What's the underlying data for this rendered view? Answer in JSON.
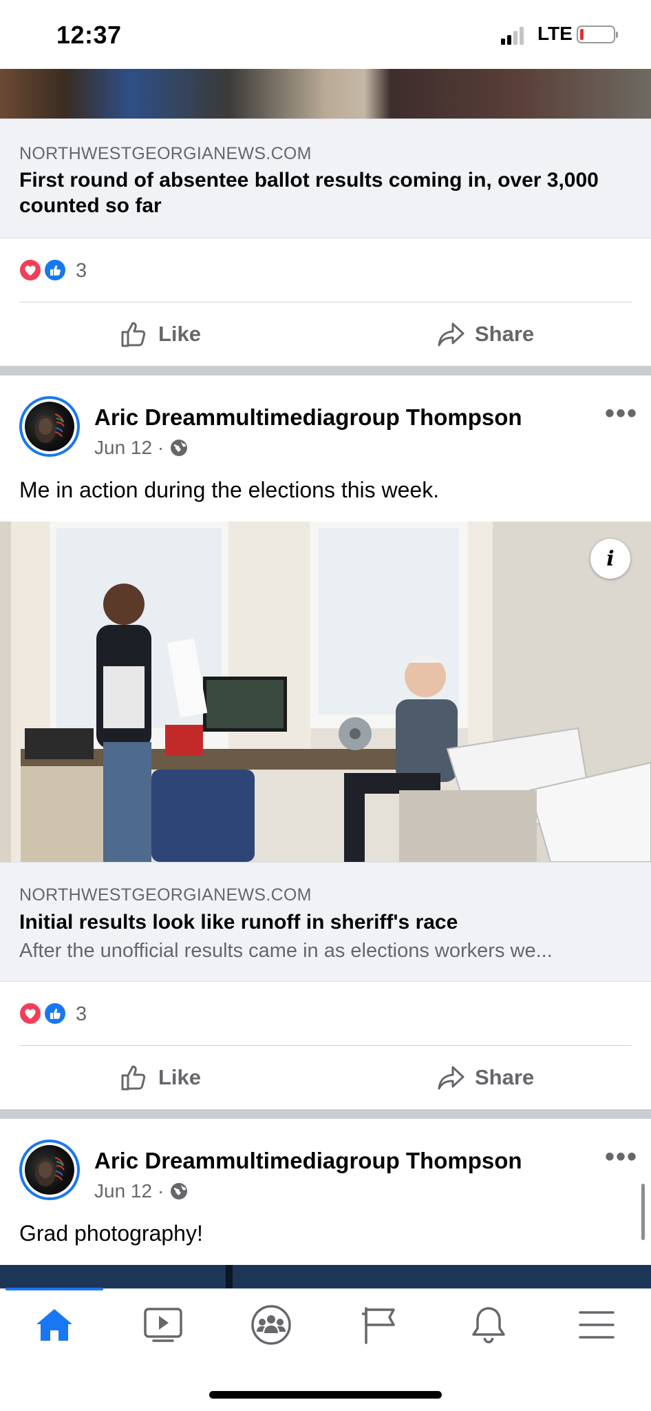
{
  "status": {
    "time": "12:37",
    "network": "LTE"
  },
  "posts": [
    {
      "link": {
        "domain": "NORTHWESTGEORGIANEWS.COM",
        "title": "First round of absentee ballot results coming in, over 3,000 counted so far"
      },
      "reactions": {
        "count": "3"
      },
      "actions": {
        "like": "Like",
        "share": "Share"
      }
    },
    {
      "author": "Aric Dreammultimediagroup Thompson",
      "date": "Jun 12 ·",
      "text": "Me in action during the elections this week.",
      "photo_info": "i",
      "link": {
        "domain": "NORTHWESTGEORGIANEWS.COM",
        "title": "Initial results look like runoff in sheriff's race",
        "description": "After the unofficial results came in as elections workers we..."
      },
      "reactions": {
        "count": "3"
      },
      "actions": {
        "like": "Like",
        "share": "Share"
      }
    },
    {
      "author": "Aric Dreammultimediagroup Thompson",
      "date": "Jun 12 ·",
      "text": "Grad photography!"
    }
  ],
  "nav": {
    "items": [
      {
        "icon": "home-icon",
        "active": true
      },
      {
        "icon": "watch-icon",
        "active": false
      },
      {
        "icon": "groups-icon",
        "active": false
      },
      {
        "icon": "pages-flag-icon",
        "active": false
      },
      {
        "icon": "notifications-bell-icon",
        "active": false
      },
      {
        "icon": "menu-icon",
        "active": false
      }
    ]
  },
  "colors": {
    "accent": "#1877f2",
    "secondary_text": "#65676b",
    "heart": "#f33e58",
    "battery_low": "#e03030"
  }
}
